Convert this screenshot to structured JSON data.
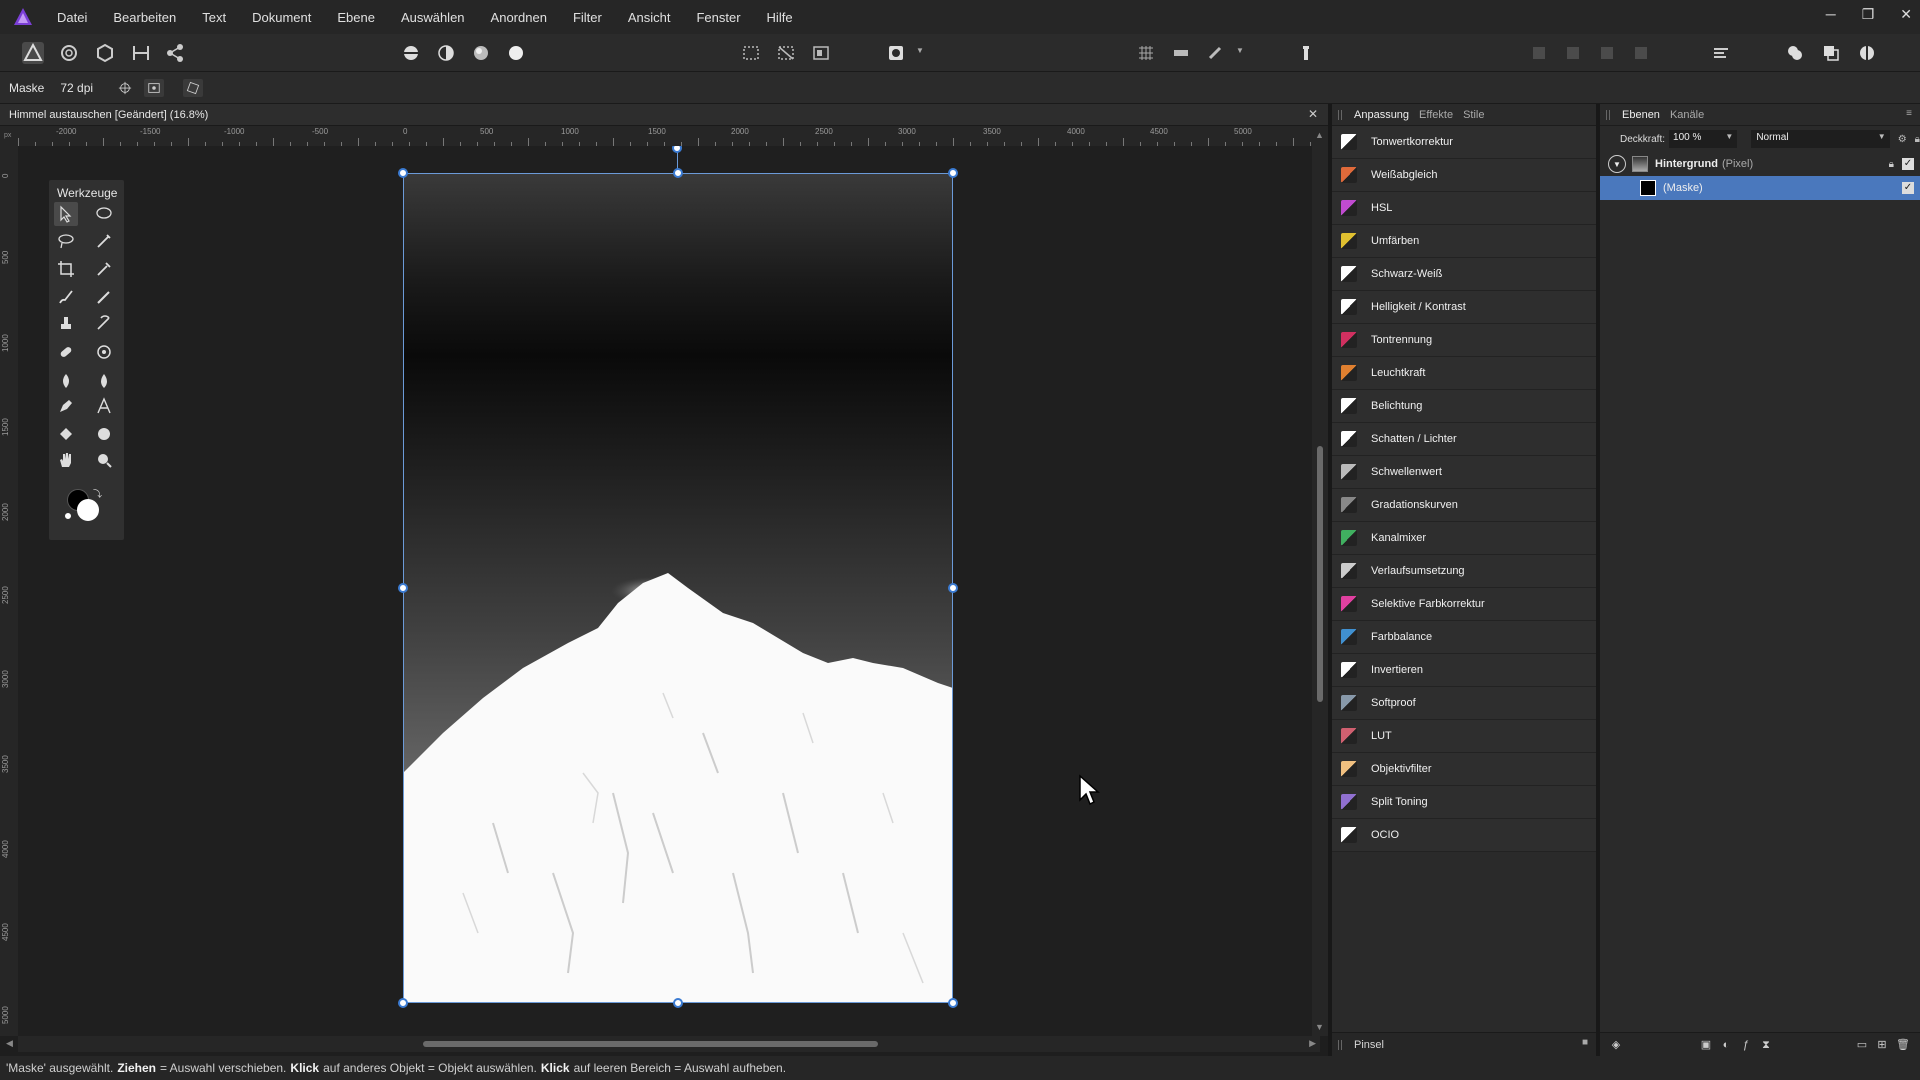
{
  "menubar": {
    "items": [
      "Datei",
      "Bearbeiten",
      "Text",
      "Dokument",
      "Ebene",
      "Auswählen",
      "Anordnen",
      "Filter",
      "Ansicht",
      "Fenster",
      "Hilfe"
    ]
  },
  "context": {
    "label": "Maske",
    "dpi": "72 dpi"
  },
  "document": {
    "tab_title": "Himmel austauschen [Geändert] (16.8%)",
    "close_glyph": "✕"
  },
  "rulers": {
    "corner_unit": "px",
    "h_labels": [
      "-2000",
      "-1500",
      "-1000",
      "-500",
      "0",
      "500",
      "1000",
      "1500",
      "2000",
      "2500",
      "3000",
      "3500",
      "4000",
      "4500",
      "5000"
    ],
    "v_labels": [
      "0",
      "500",
      "1000",
      "1500",
      "2000",
      "2500",
      "3000",
      "3500",
      "4000",
      "4500",
      "5000"
    ]
  },
  "tools": {
    "title": "Werkzeuge"
  },
  "adjustments": {
    "tabs": [
      "Anpassung",
      "Effekte",
      "Stile"
    ],
    "items": [
      {
        "label": "Tonwertkorrektur",
        "color": "#ffffff"
      },
      {
        "label": "Weißabgleich",
        "color": "#e06a3a"
      },
      {
        "label": "HSL",
        "color": "#c04bd0"
      },
      {
        "label": "Umfärben",
        "color": "#e0c030"
      },
      {
        "label": "Schwarz-Weiß",
        "color": "#ffffff"
      },
      {
        "label": "Helligkeit / Kontrast",
        "color": "#ffffff"
      },
      {
        "label": "Tontrennung",
        "color": "#d03060"
      },
      {
        "label": "Leuchtkraft",
        "color": "#e08030"
      },
      {
        "label": "Belichtung",
        "color": "#ffffff"
      },
      {
        "label": "Schatten / Lichter",
        "color": "#ffffff"
      },
      {
        "label": "Schwellenwert",
        "color": "#bbbbbb"
      },
      {
        "label": "Gradationskurven",
        "color": "#888888"
      },
      {
        "label": "Kanalmixer",
        "color": "#40b060"
      },
      {
        "label": "Verlaufsumsetzung",
        "color": "#cccccc"
      },
      {
        "label": "Selektive Farbkorrektur",
        "color": "#e040a0"
      },
      {
        "label": "Farbbalance",
        "color": "#4090d0"
      },
      {
        "label": "Invertieren",
        "color": "#ffffff"
      },
      {
        "label": "Softproof",
        "color": "#8899aa"
      },
      {
        "label": "LUT",
        "color": "#d06070"
      },
      {
        "label": "Objektivfilter",
        "color": "#f0c080"
      },
      {
        "label": "Split Toning",
        "color": "#9070d0"
      },
      {
        "label": "OCIO",
        "color": "#ffffff"
      }
    ],
    "footer": "Pinsel"
  },
  "layers": {
    "tabs": [
      "Ebenen",
      "Kanäle"
    ],
    "opacity_label": "Deckkraft:",
    "opacity_value": "100 %",
    "blend_mode": "Normal",
    "rows": [
      {
        "name": "Hintergrund",
        "type": "(Pixel)"
      },
      {
        "name": "(Maske)",
        "type": ""
      }
    ]
  },
  "status": {
    "p1": "'Maske' ausgewählt.",
    "b1": "Ziehen",
    "p2": "= Auswahl verschieben.",
    "b2": "Klick",
    "p3": "auf anderes Objekt = Objekt auswählen.",
    "b3": "Klick",
    "p4": "auf leeren Bereich = Auswahl aufheben."
  },
  "colors": {
    "accent": "#4a78bd",
    "selection": "#3b7bd2"
  }
}
